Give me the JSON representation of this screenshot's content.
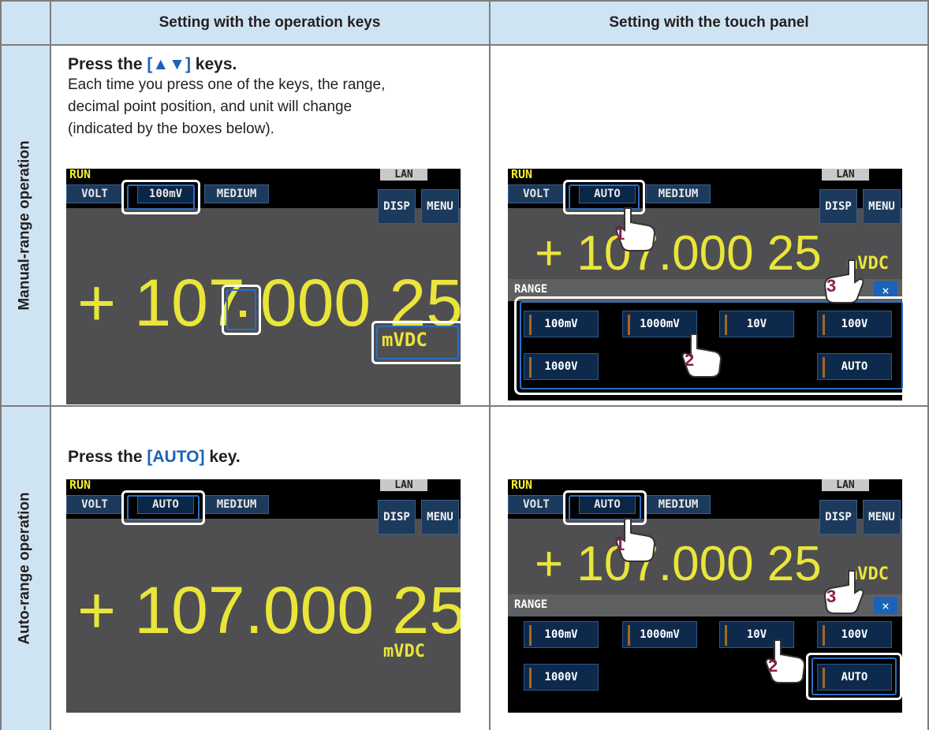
{
  "header": {
    "col1": "Setting with the operation keys",
    "col2": "Setting with the touch panel"
  },
  "rows": [
    {
      "label": "Manual-range operation",
      "key_step": {
        "prefix": "Press the ",
        "key": "[▲▼]",
        "suffix": " keys.",
        "desc_lines": [
          "Each time you press one of the keys, the range,",
          "decimal point position, and unit will change",
          "(indicated by the boxes below)."
        ]
      }
    },
    {
      "label": "Auto-range operation",
      "key_step": {
        "prefix": "Press the ",
        "key": "[AUTO]",
        "suffix": " key."
      }
    }
  ],
  "screen": {
    "run": "RUN",
    "lan": "LAN",
    "volt": "VOLT",
    "medium": "MEDIUM",
    "disp": "DISP",
    "menu": "MENU",
    "range_manual": "100mV",
    "range_auto": "AUTO",
    "reading": "+ 107.000 25",
    "reading_part1": "+ 107",
    "reading_part2": "000 25",
    "unit": "mVDC",
    "range_title": "RANGE",
    "close": "×",
    "range_buttons": [
      "100mV",
      "1000mV",
      "10V",
      "100V",
      "1000V",
      "AUTO"
    ]
  },
  "steps": [
    "1",
    "2",
    "3"
  ],
  "colors": {
    "header_bg": "#cfe4f3",
    "key_blue": "#1a63b8",
    "display_yellow": "#e9e53a",
    "step_number": "#8b1f4a"
  }
}
